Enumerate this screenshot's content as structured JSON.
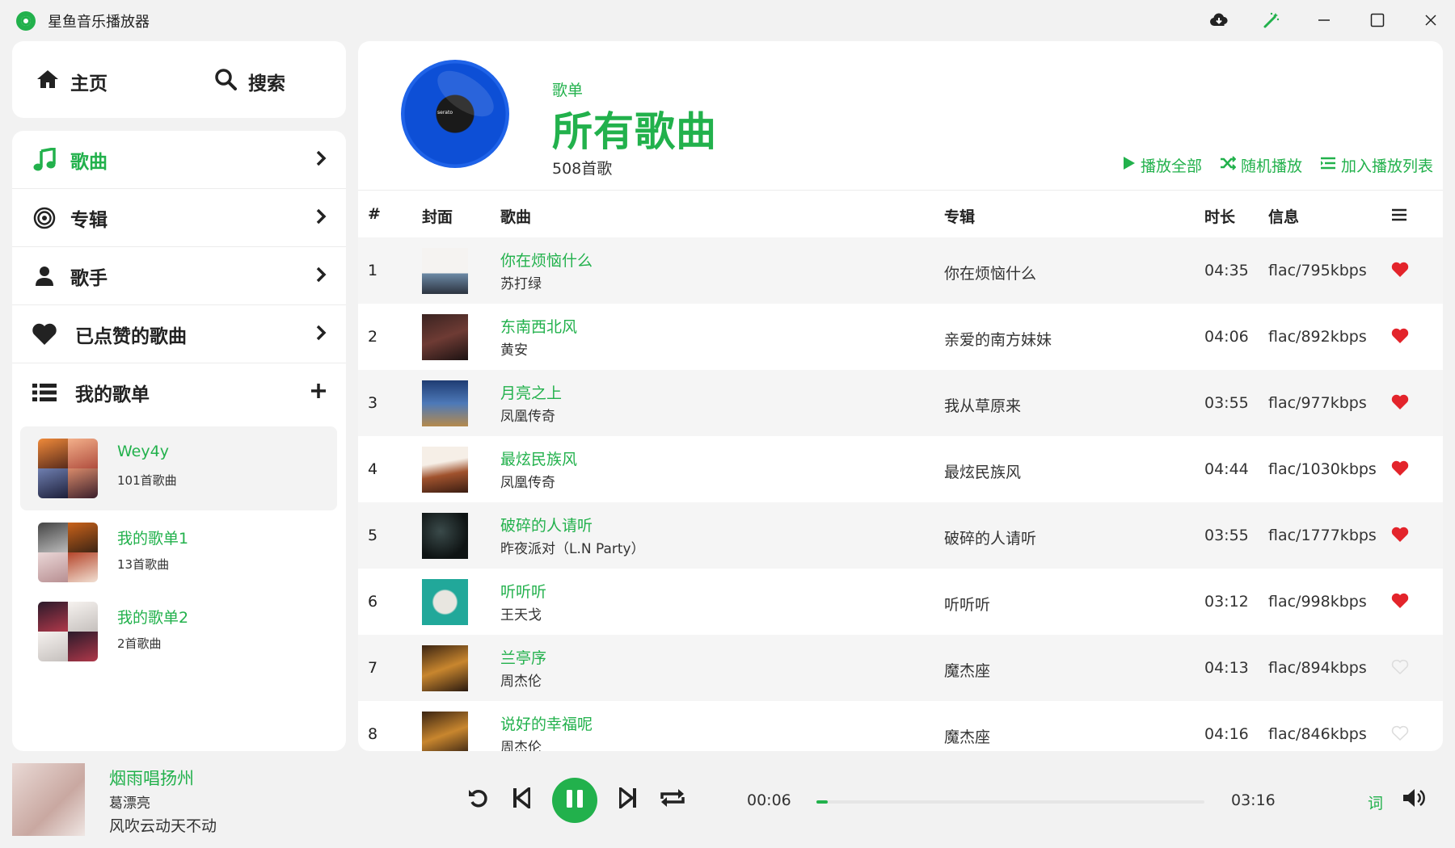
{
  "app": {
    "title": "星鱼音乐播放器",
    "accent": "#22b14c",
    "favorite_color": "#e3242b",
    "icons": [
      "cloud-download-icon",
      "magic-wand-icon",
      "minimize-icon",
      "maximize-icon",
      "close-icon"
    ]
  },
  "nav": {
    "home": "主页",
    "search": "搜索"
  },
  "library": {
    "items": [
      {
        "label": "歌曲",
        "icon": "music-note-icon",
        "active": true
      },
      {
        "label": "专辑",
        "icon": "record-icon",
        "active": false
      },
      {
        "label": "歌手",
        "icon": "person-icon",
        "active": false
      },
      {
        "label": "已点赞的歌曲",
        "icon": "heart-icon",
        "active": false
      }
    ],
    "my_playlists_label": "我的歌单",
    "playlists": [
      {
        "name": "Wey4y",
        "count": "101首歌曲",
        "selected": true
      },
      {
        "name": "我的歌单1",
        "count": "13首歌曲",
        "selected": false
      },
      {
        "name": "我的歌单2",
        "count": "2首歌曲",
        "selected": false
      }
    ]
  },
  "header": {
    "subtitle": "歌单",
    "title": "所有歌曲",
    "count": "508首歌",
    "vinyl_brand": "serato",
    "actions": {
      "play_all": "播放全部",
      "shuffle": "随机播放",
      "add_to_queue": "加入播放列表"
    }
  },
  "table": {
    "columns": {
      "num": "#",
      "cover": "封面",
      "song": "歌曲",
      "album": "专辑",
      "duration": "时长",
      "info": "信息"
    },
    "rows": [
      {
        "num": "1",
        "title": "你在烦恼什么",
        "artist": "苏打绿",
        "album": "你在烦恼什么",
        "duration": "04:35",
        "info": "flac/795kbps",
        "liked": true
      },
      {
        "num": "2",
        "title": "东南西北风",
        "artist": "黄安",
        "album": "亲爱的南方妹妹",
        "duration": "04:06",
        "info": "flac/892kbps",
        "liked": true
      },
      {
        "num": "3",
        "title": "月亮之上",
        "artist": "凤凰传奇",
        "album": "我从草原来",
        "duration": "03:55",
        "info": "flac/977kbps",
        "liked": true
      },
      {
        "num": "4",
        "title": "最炫民族风",
        "artist": "凤凰传奇",
        "album": "最炫民族风",
        "duration": "04:44",
        "info": "flac/1030kbps",
        "liked": true
      },
      {
        "num": "5",
        "title": "破碎的人请听",
        "artist": "昨夜派对（L.N Party）",
        "album": "破碎的人请听",
        "duration": "03:55",
        "info": "flac/1777kbps",
        "liked": true
      },
      {
        "num": "6",
        "title": "听听听",
        "artist": "王天戈",
        "album": "听听听",
        "duration": "03:12",
        "info": "flac/998kbps",
        "liked": true
      },
      {
        "num": "7",
        "title": "兰亭序",
        "artist": "周杰伦",
        "album": "魔杰座",
        "duration": "04:13",
        "info": "flac/894kbps",
        "liked": false
      },
      {
        "num": "8",
        "title": "说好的幸福呢",
        "artist": "周杰伦",
        "album": "魔杰座",
        "duration": "04:16",
        "info": "flac/846kbps",
        "liked": false
      }
    ]
  },
  "player": {
    "title": "烟雨唱扬州",
    "artist": "葛漂亮",
    "lyric": "风吹云动天不动",
    "current_time": "00:06",
    "total_time": "03:16",
    "progress_fraction": 0.03,
    "lyric_button": "词",
    "controls": [
      "replay-icon",
      "previous-icon",
      "pause-icon",
      "next-icon",
      "repeat-icon",
      "volume-icon"
    ]
  }
}
